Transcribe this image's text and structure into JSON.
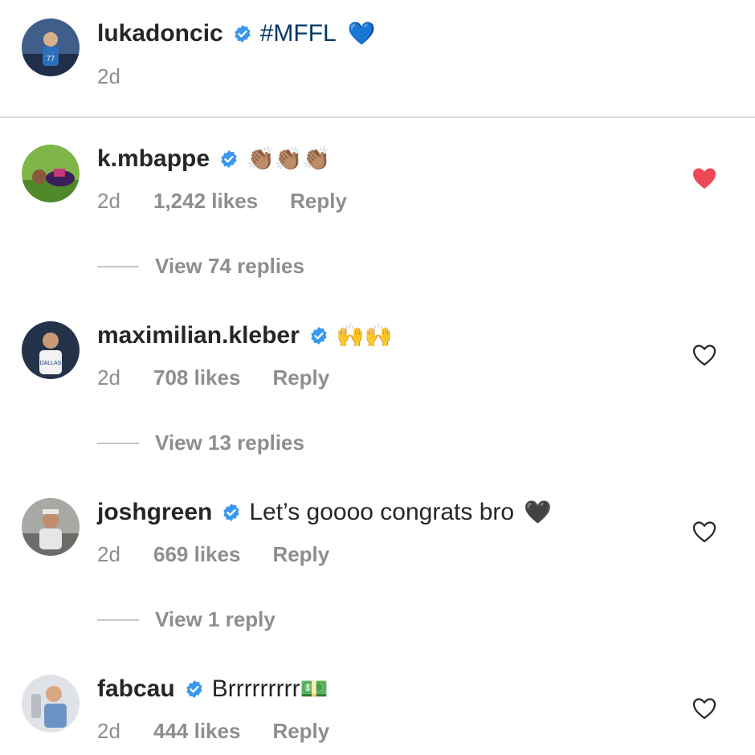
{
  "caption": {
    "username": "lukadoncic",
    "text": "#MFFL",
    "emoji": "💙",
    "time": "2d"
  },
  "comments": [
    {
      "username": "k.mbappe",
      "text": "",
      "emoji": "👏🏽👏🏽👏🏽",
      "time": "2d",
      "likes": "1,242 likes",
      "reply_label": "Reply",
      "view_replies": "View 74 replies",
      "liked": true
    },
    {
      "username": "maximilian.kleber",
      "text": "",
      "emoji": "🙌🙌",
      "time": "2d",
      "likes": "708 likes",
      "reply_label": "Reply",
      "view_replies": "View 13 replies",
      "liked": false
    },
    {
      "username": "joshgreen",
      "text": "Let’s goooo congrats bro",
      "emoji": "🖤",
      "time": "2d",
      "likes": "669 likes",
      "reply_label": "Reply",
      "view_replies": "View 1 reply",
      "liked": false
    },
    {
      "username": "fabcau",
      "text": "Brrrrrrrrr",
      "emoji": "💵",
      "time": "2d",
      "likes": "444 likes",
      "reply_label": "Reply",
      "view_replies": "",
      "liked": false
    }
  ],
  "colors": {
    "verified_blue": "#3897f0",
    "like_red": "#ed4956",
    "secondary_text": "#8e8e8e",
    "hashtag_link": "#00376b"
  }
}
